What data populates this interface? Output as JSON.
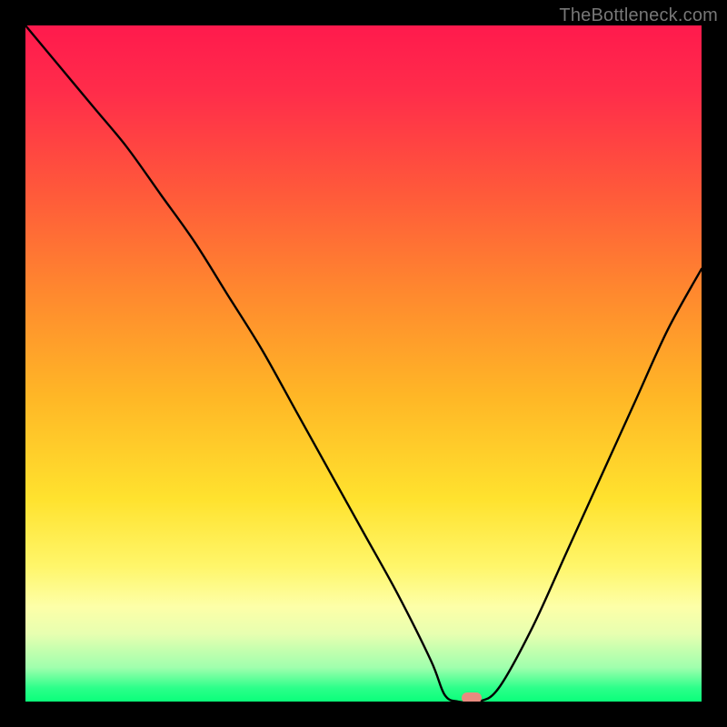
{
  "watermark": "TheBottleneck.com",
  "chart_data": {
    "type": "line",
    "title": "",
    "xlabel": "",
    "ylabel": "",
    "xlim": [
      0,
      100
    ],
    "ylim": [
      0,
      100
    ],
    "grid": false,
    "legend": false,
    "background_gradient": {
      "top": "#ff1a4d",
      "mid_orange": "#ff8a2e",
      "mid_yellow": "#ffe22e",
      "bottom_green": "#0aff7a"
    },
    "series": [
      {
        "name": "bottleneck-curve",
        "color": "#000000",
        "x": [
          0,
          5,
          10,
          15,
          20,
          25,
          30,
          35,
          40,
          45,
          50,
          55,
          60,
          62,
          64,
          67,
          70,
          75,
          80,
          85,
          90,
          95,
          100
        ],
        "y": [
          100,
          94,
          88,
          82,
          75,
          68,
          60,
          52,
          43,
          34,
          25,
          16,
          6,
          1,
          0,
          0,
          2,
          11,
          22,
          33,
          44,
          55,
          64
        ]
      }
    ],
    "marker": {
      "x": 66,
      "y": 0,
      "color": "#e88a7f"
    }
  }
}
